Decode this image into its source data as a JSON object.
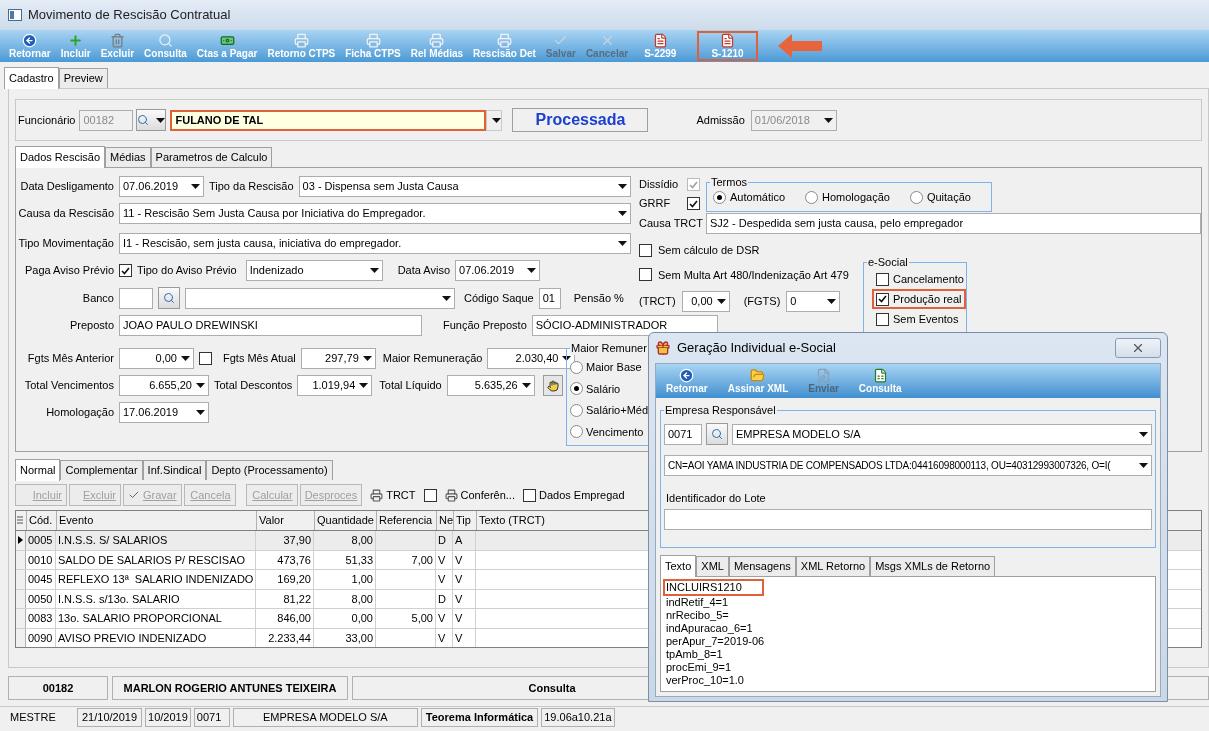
{
  "window": {
    "title": "Movimento de Rescisão Contratual"
  },
  "toolbar": [
    {
      "label": "Retornar",
      "kind": "back",
      "disabled": false,
      "highlighted": false
    },
    {
      "label": "Incluir",
      "kind": "add",
      "disabled": false,
      "highlighted": false
    },
    {
      "label": "Excluir",
      "kind": "trash",
      "disabled": false,
      "highlighted": false
    },
    {
      "label": "Consulta",
      "kind": "search",
      "disabled": false,
      "highlighted": false
    },
    {
      "label": "Ctas a Pagar",
      "kind": "money",
      "disabled": false,
      "highlighted": false
    },
    {
      "label": "Retorno CTPS",
      "kind": "print",
      "disabled": false,
      "highlighted": false
    },
    {
      "label": "Ficha CTPS",
      "kind": "print",
      "disabled": false,
      "highlighted": false
    },
    {
      "label": "Rel Médias",
      "kind": "print",
      "disabled": false,
      "highlighted": false
    },
    {
      "label": "Rescisão Det",
      "kind": "print",
      "disabled": false,
      "highlighted": false
    },
    {
      "label": "Salvar",
      "kind": "check",
      "disabled": true,
      "highlighted": false
    },
    {
      "label": "Cancelar",
      "kind": "cancel",
      "disabled": true,
      "highlighted": false
    },
    {
      "label": "S-2299",
      "kind": "doc",
      "disabled": false,
      "highlighted": false
    },
    {
      "label": "S-1210",
      "kind": "doc",
      "disabled": false,
      "highlighted": true
    }
  ],
  "page_tabs": [
    {
      "label": "Cadastro",
      "selected": true
    },
    {
      "label": "Preview",
      "selected": false
    }
  ],
  "employee": {
    "label": "Funcionário",
    "code": "00182",
    "name": "FULANO DE TAL",
    "highlighted": true,
    "status": "Processada",
    "admission_label": "Admissão",
    "admission": "01/06/2018"
  },
  "form_tabs": [
    {
      "label": "Dados Rescisão",
      "selected": true
    },
    {
      "label": "Médias",
      "selected": false
    },
    {
      "label": "Parametros de Calculo",
      "selected": false
    }
  ],
  "form": {
    "data_desligamento": {
      "label": "Data Desligamento",
      "value": "07.06.2019"
    },
    "tipo_rescisao": {
      "label": "Tipo da Rescisão",
      "value": "03 - Dispensa sem Justa Causa"
    },
    "causa_rescisao": {
      "label": "Causa da Rescisão",
      "value": "11 - Rescisão Sem Justa Causa por Iniciativa do Empregador."
    },
    "tipo_movimentacao": {
      "label": "Tipo Movimentação",
      "value": "I1 - Rescisão, sem justa causa, iniciativa do empregador."
    },
    "paga_aviso": {
      "label": "Paga Aviso Prévio",
      "checked": true
    },
    "tipo_aviso": {
      "label": "Tipo do Aviso Prévio",
      "value": "Indenizado"
    },
    "data_aviso": {
      "label": "Data Aviso",
      "value": "07.06.2019"
    },
    "banco": {
      "label": "Banco"
    },
    "codigo_saque": {
      "label": "Código Saque",
      "value": "01"
    },
    "pensao": {
      "label": "Pensão %",
      "trct_label": "(TRCT)",
      "trct": "0,00",
      "fgts_label": "(FGTS)",
      "fgts": "0"
    },
    "preposto": {
      "label": "Preposto",
      "value": "JOAO PAULO DREWINSKI"
    },
    "funcao_preposto": {
      "label": "Função Preposto",
      "value": "SÓCIO-ADMINISTRADOR"
    },
    "fgts_mes_anterior": {
      "label": "Fgts Mês Anterior",
      "value": "0,00",
      "checked": false
    },
    "fgts_mes_atual": {
      "label": "Fgts Mês Atual",
      "value": "297,79"
    },
    "maior_remuneracao": {
      "label": "Maior Remuneração",
      "value": "2.030,40"
    },
    "total_vencimentos": {
      "label": "Total Vencimentos",
      "value": "6.655,20"
    },
    "total_descontos": {
      "label": "Total Descontos",
      "value": "1.019,94"
    },
    "total_liquido": {
      "label": "Total Líquido",
      "value": "5.635,26"
    },
    "homologacao": {
      "label": "Homologação",
      "value": "17.06.2019"
    },
    "maior_remuner_group": {
      "title": "Maior Remuner",
      "options": [
        {
          "label": "Maior Base",
          "selected": false
        },
        {
          "label": "Salário",
          "selected": true
        },
        {
          "label": "Salário+Méd",
          "selected": false
        },
        {
          "label": "Vencimento",
          "selected": false
        }
      ]
    },
    "dissidio": {
      "label": "Dissídio",
      "checked": true,
      "disabled": true
    },
    "grrf": {
      "label": "GRRF",
      "checked": true,
      "disabled": false
    },
    "termos": {
      "title": "Termos",
      "options": [
        {
          "label": "Automático",
          "selected": true
        },
        {
          "label": "Homologação",
          "selected": false
        },
        {
          "label": "Quitação",
          "selected": false
        }
      ]
    },
    "causa_trct": {
      "label": "Causa TRCT",
      "value": "SJ2 - Despedida sem justa causa, pelo empregador"
    },
    "sem_dsr": {
      "label": "Sem cálculo de DSR",
      "checked": false
    },
    "sem_multa": {
      "label": "Sem Multa Art 480/Indenização Art 479",
      "checked": false
    },
    "esocial": {
      "title": "e-Social",
      "options": [
        {
          "label": "Cancelamento",
          "checked": false,
          "highlighted": false
        },
        {
          "label": "Produção real",
          "checked": true,
          "highlighted": true
        },
        {
          "label": "Sem Eventos",
          "checked": false,
          "highlighted": false
        }
      ]
    }
  },
  "event_tabs": [
    {
      "label": "Normal",
      "selected": true
    },
    {
      "label": "Complementar",
      "selected": false
    },
    {
      "label": "Inf.Sindical",
      "selected": false
    },
    {
      "label": "Depto (Processamento)",
      "selected": false
    }
  ],
  "event_toolbar": [
    {
      "kind": "button",
      "label": "Incluir",
      "disabled": true
    },
    {
      "kind": "button",
      "label": "Excluir",
      "disabled": true
    },
    {
      "kind": "check",
      "label": "Gravar",
      "disabled": true
    },
    {
      "kind": "button",
      "label": "Cancela",
      "disabled": true
    },
    {
      "kind": "button",
      "label": "Calcular",
      "disabled": true
    },
    {
      "kind": "button",
      "label": "Desproces",
      "disabled": true
    },
    {
      "kind": "print",
      "label": "TRCT"
    },
    {
      "kind": "checkbox",
      "checked": false
    },
    {
      "kind": "print",
      "label": "Conferên..."
    },
    {
      "kind": "checkbox",
      "label": "Dados Empregad",
      "checked": false
    }
  ],
  "table": {
    "columns": [
      "Cód.",
      "Evento",
      "Valor",
      "Quantidade",
      "Referencia",
      "Ne",
      "Tip",
      "Texto (TRCT)"
    ],
    "rows": [
      {
        "code": "0005",
        "event": "I.N.S.S. S/ SALARIOS",
        "value": "37,90",
        "quantity": "8,00",
        "ne": "D",
        "type": "A",
        "selected": true
      },
      {
        "code": "0010",
        "event": "SALDO DE SALARIOS P/ RESCISAO",
        "value": "473,76",
        "quantity": "51,33",
        "reference": "7,00",
        "ne": "V",
        "type": "V",
        "selected": false
      },
      {
        "code": "0045",
        "event": "REFLEXO 13ª  SALARIO INDENIZADO",
        "value": "169,20",
        "quantity": "1,00",
        "ne": "V",
        "type": "V",
        "selected": false
      },
      {
        "code": "0050",
        "event": "I.N.S.S. s/13o. SALARIO",
        "value": "81,22",
        "quantity": "8,00",
        "ne": "D",
        "type": "V",
        "selected": false
      },
      {
        "code": "0083",
        "event": "13o. SALARIO PROPORCIONAL",
        "value": "846,00",
        "quantity": "0,00",
        "reference": "5,00",
        "ne": "V",
        "type": "V",
        "selected": false
      },
      {
        "code": "0090",
        "event": "AVISO PREVIO INDENIZADO",
        "value": "2.233,44",
        "quantity": "33,00",
        "ne": "V",
        "type": "V",
        "selected": false
      }
    ]
  },
  "footer": {
    "code": "00182",
    "name": "MARLON ROGERIO ANTUNES TEIXEIRA",
    "mode": "Consulta"
  },
  "status_bar": {
    "user": "MESTRE",
    "date": "21/10/2019",
    "period": "10/2019",
    "company_code": "0071",
    "company": "EMPRESA MODELO S/A",
    "vendor": "Teorema Informática",
    "version": "19.06a10.21a"
  },
  "dialog": {
    "title": "Geração Individual e-Social",
    "toolbar": [
      {
        "label": "Retornar",
        "kind": "back",
        "disabled": false
      },
      {
        "label": "Assinar XML",
        "kind": "folder",
        "disabled": false
      },
      {
        "label": "Enviar",
        "kind": "edit",
        "disabled": true
      },
      {
        "label": "Consulta",
        "kind": "sheet",
        "disabled": false
      }
    ],
    "group_title": "Empresa Responsável",
    "company_code": "0071",
    "company": "EMPRESA MODELO S/A",
    "certificate": "CN=AOI YAMA INDUSTRIA DE COMPENSADOS LTDA:04416098000113, OU=40312993007326, O=I(",
    "lote_label": "Identificador do Lote",
    "tabs": [
      {
        "label": "Texto",
        "selected": true
      },
      {
        "label": "XML",
        "selected": false
      },
      {
        "label": "Mensagens",
        "selected": false
      },
      {
        "label": "XML Retorno",
        "selected": false
      },
      {
        "label": "Msgs XMLs de Retorno",
        "selected": false
      }
    ],
    "lines": [
      {
        "text": "INCLUIRS1210",
        "highlighted": true
      },
      {
        "text": "indRetif_4=1",
        "highlighted": false
      },
      {
        "text": "nrRecibo_5=",
        "highlighted": false
      },
      {
        "text": "indApuracao_6=1",
        "highlighted": false
      },
      {
        "text": "perApur_7=2019-06",
        "highlighted": false
      },
      {
        "text": "tpAmb_8=1",
        "highlighted": false
      },
      {
        "text": "procEmi_9=1",
        "highlighted": false
      },
      {
        "text": "verProc_10=1.0",
        "highlighted": false
      }
    ]
  }
}
